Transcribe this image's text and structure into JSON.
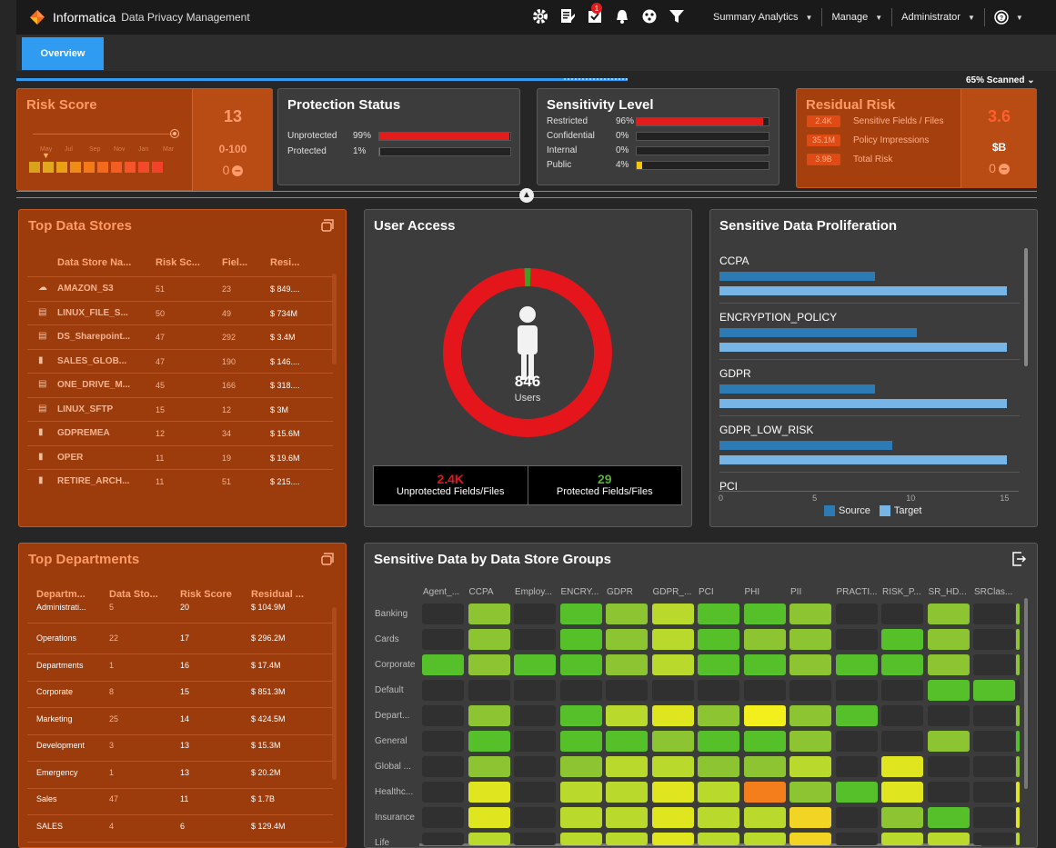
{
  "app": {
    "brand": "Informatica",
    "product": "Data Privacy Management"
  },
  "top_menus": {
    "summary": "Summary Analytics",
    "manage": "Manage",
    "admin": "Administrator"
  },
  "notification_count": "1",
  "icons": [
    "gear-icon",
    "report-icon",
    "tasks-icon",
    "bell-icon",
    "dashboard-icon",
    "filter-icon",
    "help-icon"
  ],
  "tabs": {
    "overview": "Overview"
  },
  "scan_status": "65% Scanned",
  "risk_score": {
    "title": "Risk Score",
    "value": "13",
    "range": "0-100",
    "count": "0",
    "months": [
      "May",
      "Jul",
      "Sep",
      "Nov",
      "Jan",
      "Mar"
    ]
  },
  "protection_status": {
    "title": "Protection Status",
    "rows": [
      {
        "label": "Unprotected",
        "pct": "99%",
        "value": 0.99,
        "color": "#e21b1b"
      },
      {
        "label": "Protected",
        "pct": "1%",
        "value": 0.01,
        "color": "#44a020"
      }
    ]
  },
  "sensitivity_level": {
    "title": "Sensitivity Level",
    "rows": [
      {
        "label": "Restricted",
        "pct": "96%",
        "value": 0.96,
        "color": "#e21b1b"
      },
      {
        "label": "Confidential",
        "pct": "0%",
        "value": 0,
        "color": "#e21b1b"
      },
      {
        "label": "Internal",
        "pct": "0%",
        "value": 0,
        "color": "#e21b1b"
      },
      {
        "label": "Public",
        "pct": "4%",
        "value": 0.04,
        "color": "#f2c80f"
      }
    ]
  },
  "residual_risk": {
    "title": "Residual Risk",
    "value": "3.6",
    "unit": "$B",
    "count": "0",
    "items": [
      {
        "chip": "2.4K",
        "label": "Sensitive Fields / Files"
      },
      {
        "chip": "35.1M",
        "label": "Policy Impressions"
      },
      {
        "chip": "3.9B",
        "label": "Total Risk"
      }
    ]
  },
  "top_data_stores": {
    "title": "Top Data Stores",
    "headers": [
      "Data Store Na...",
      "Risk Sc...",
      "Fiel...",
      "Resi..."
    ],
    "rows": [
      {
        "icon": "cloud-icon",
        "name": "AMAZON_S3",
        "risk": "51",
        "fields": "23",
        "residual": "$ 849...."
      },
      {
        "icon": "file-icon",
        "name": "LINUX_FILE_S...",
        "risk": "50",
        "fields": "49",
        "residual": "$ 734M"
      },
      {
        "icon": "file-icon",
        "name": "DS_Sharepoint...",
        "risk": "47",
        "fields": "292",
        "residual": "$ 3.4M"
      },
      {
        "icon": "database-icon",
        "name": "SALES_GLOB...",
        "risk": "47",
        "fields": "190",
        "residual": "$ 146...."
      },
      {
        "icon": "file-icon",
        "name": "ONE_DRIVE_M...",
        "risk": "45",
        "fields": "166",
        "residual": "$ 318...."
      },
      {
        "icon": "file-icon",
        "name": "LINUX_SFTP",
        "risk": "15",
        "fields": "12",
        "residual": "$ 3M"
      },
      {
        "icon": "database-icon",
        "name": "GDPREMEA",
        "risk": "12",
        "fields": "34",
        "residual": "$ 15.6M"
      },
      {
        "icon": "database-icon",
        "name": "OPER",
        "risk": "11",
        "fields": "19",
        "residual": "$ 19.6M"
      },
      {
        "icon": "database-icon",
        "name": "RETIRE_ARCH...",
        "risk": "11",
        "fields": "51",
        "residual": "$ 215...."
      }
    ]
  },
  "top_departments": {
    "title": "Top Departments",
    "headers": [
      "Departm...",
      "Data Sto...",
      "Risk Score",
      "Residual ..."
    ],
    "rows": [
      {
        "name": "Administrati...",
        "stores": "5",
        "risk": "20",
        "residual": "$ 104.9M"
      },
      {
        "name": "Operations",
        "stores": "22",
        "risk": "17",
        "residual": "$ 296.2M"
      },
      {
        "name": "Departments",
        "stores": "1",
        "risk": "16",
        "residual": "$ 17.4M"
      },
      {
        "name": "Corporate",
        "stores": "8",
        "risk": "15",
        "residual": "$ 851.3M"
      },
      {
        "name": "Marketing",
        "stores": "25",
        "risk": "14",
        "residual": "$ 424.5M"
      },
      {
        "name": "Development",
        "stores": "3",
        "risk": "13",
        "residual": "$ 15.3M"
      },
      {
        "name": "Emergency",
        "stores": "1",
        "risk": "13",
        "residual": "$ 20.2M"
      },
      {
        "name": "Sales",
        "stores": "47",
        "risk": "11",
        "residual": "$ 1.7B"
      },
      {
        "name": "SALES",
        "stores": "4",
        "risk": "6",
        "residual": "$ 129.4M"
      }
    ]
  },
  "user_access": {
    "title": "User Access",
    "users": "846",
    "users_label": "Users",
    "protected_share": 0.012,
    "unprotected": "2.4K",
    "unprotected_label": "Unprotected Fields/Files",
    "protected": "29",
    "protected_label": "Protected Fields/Files"
  },
  "chart_data": {
    "type": "bar",
    "title": "Sensitive Data Proliferation",
    "categories": [
      "CCPA",
      "ENCRYPTION_POLICY",
      "GDPR",
      "GDPR_LOW_RISK",
      "PCI"
    ],
    "series": [
      {
        "name": "Source",
        "values": [
          8.3,
          10.5,
          8.3,
          9.2,
          0
        ],
        "color": "#2d7bb5"
      },
      {
        "name": "Target",
        "values": [
          15.3,
          15.3,
          15.3,
          15.3,
          0
        ],
        "color": "#76b5e6"
      }
    ],
    "xticks": [
      "0",
      "5",
      "10",
      "15"
    ],
    "xlim": [
      0,
      16
    ],
    "legend": "bottom"
  },
  "heatmap": {
    "title": "Sensitive Data by Data Store Groups",
    "columns": [
      "Agent_...",
      "CCPA",
      "Employ...",
      "ENCRY...",
      "GDPR",
      "GDPR_...",
      "PCI",
      "PHI",
      "PII",
      "PRACTI...",
      "RISK_P...",
      "SR_HD...",
      "SRClas..."
    ],
    "rows": [
      "Banking",
      "Cards",
      "Corporate",
      "Default",
      "Depart...",
      "General",
      "Global ...",
      "Healthc...",
      "Insurance",
      "Life"
    ],
    "cells": [
      [
        "e",
        "b",
        "e",
        "c",
        "b",
        "a",
        "c",
        "c",
        "b",
        "e",
        "e",
        "b",
        "e"
      ],
      [
        "e",
        "b",
        "e",
        "c",
        "b",
        "a",
        "c",
        "b",
        "b",
        "e",
        "c",
        "b",
        "e"
      ],
      [
        "c",
        "b",
        "c",
        "c",
        "b",
        "a",
        "c",
        "c",
        "b",
        "c",
        "c",
        "b",
        "e"
      ],
      [
        "e",
        "e",
        "e",
        "e",
        "e",
        "e",
        "e",
        "e",
        "e",
        "e",
        "e",
        "c",
        "c"
      ],
      [
        "e",
        "b",
        "e",
        "c",
        "a",
        "y",
        "b",
        "Y",
        "b",
        "c",
        "e",
        "e",
        "e"
      ],
      [
        "e",
        "c",
        "e",
        "c",
        "c",
        "b",
        "c",
        "c",
        "b",
        "e",
        "e",
        "b",
        "e"
      ],
      [
        "e",
        "b",
        "e",
        "b",
        "a",
        "a",
        "b",
        "b",
        "a",
        "e",
        "y",
        "e",
        "e"
      ],
      [
        "e",
        "y",
        "e",
        "a",
        "a",
        "y",
        "a",
        "O",
        "b",
        "c",
        "y",
        "e",
        "e"
      ],
      [
        "e",
        "y",
        "e",
        "a",
        "a",
        "y",
        "a",
        "a",
        "w",
        "e",
        "b",
        "c",
        "e"
      ],
      [
        "e",
        "a",
        "e",
        "a",
        "a",
        "y",
        "a",
        "a",
        "w",
        "e",
        "a",
        "a",
        "e"
      ]
    ],
    "palette": {
      "e": "#303030",
      "c": "#56c02b",
      "b": "#8cc531",
      "a": "#b9d92d",
      "y": "#dfe51f",
      "Y": "#f2ef1c",
      "O": "#f47e1b",
      "w": "#f2d524"
    }
  }
}
